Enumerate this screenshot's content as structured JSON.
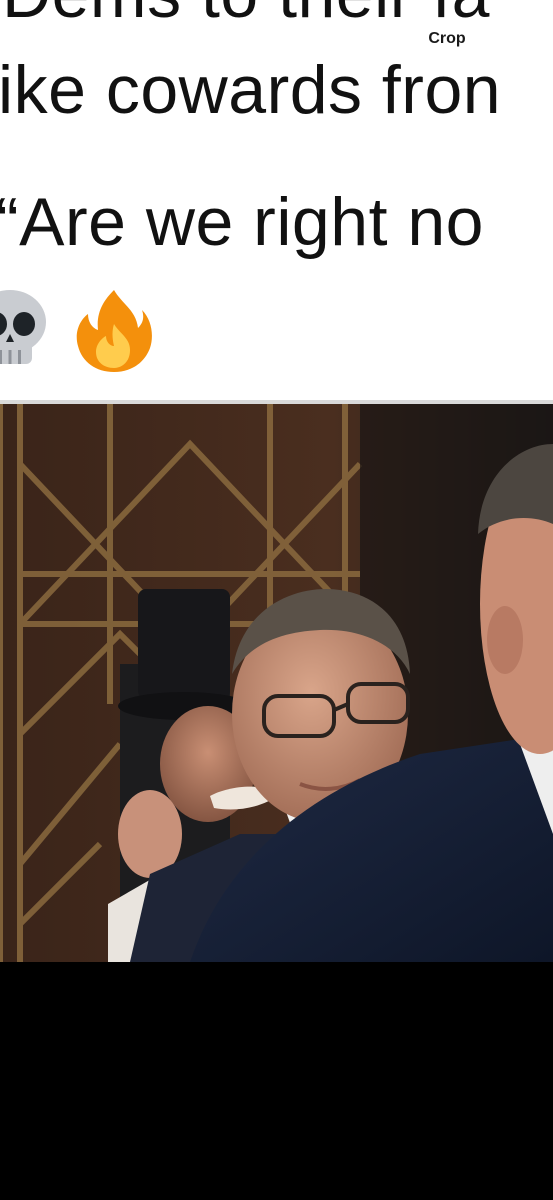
{
  "caption": {
    "line1": "Dems to their fa",
    "line2": "ike cowards fron",
    "line3": "“Are we right no"
  },
  "emojis": [
    {
      "icon": "skull-emoji-icon",
      "glyph": "💀"
    },
    {
      "icon": "fire-emoji-icon",
      "glyph": "🔥"
    }
  ],
  "toolbar": {
    "crop_label": "Crop"
  },
  "video": {
    "description_icon": "video-still-image"
  }
}
